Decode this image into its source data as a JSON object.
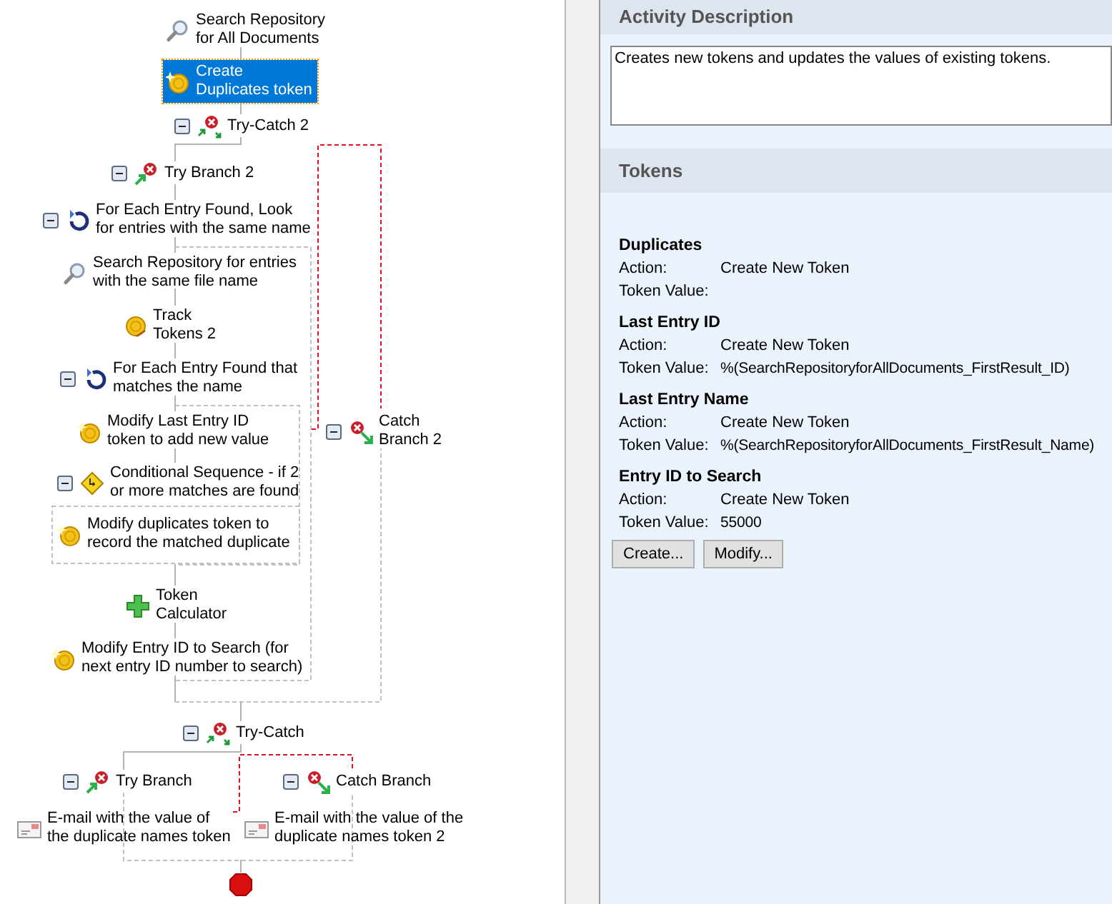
{
  "workflow": {
    "nodes": [
      {
        "kind": "search",
        "lines": [
          "Search Repository",
          "for All Documents"
        ],
        "selected": false
      },
      {
        "kind": "token",
        "lines": [
          "Create",
          "Duplicates token"
        ],
        "selected": true
      },
      {
        "kind": "trycatch",
        "lines": [
          "Try-Catch 2"
        ],
        "selected": false,
        "expanded": true
      },
      {
        "kind": "trybranch",
        "lines": [
          "Try Branch 2"
        ],
        "selected": false,
        "expanded": true
      },
      {
        "kind": "foreach",
        "lines": [
          "For Each Entry Found, Look",
          "for entries with the same name"
        ],
        "selected": false,
        "expanded": true
      },
      {
        "kind": "search",
        "lines": [
          "Search Repository for entries",
          "with the same file name"
        ],
        "selected": false
      },
      {
        "kind": "track",
        "lines": [
          "Track",
          "Tokens 2"
        ],
        "selected": false
      },
      {
        "kind": "foreach",
        "lines": [
          "For Each Entry Found that",
          "matches the name"
        ],
        "selected": false,
        "expanded": true
      },
      {
        "kind": "token",
        "lines": [
          "Modify Last Entry ID",
          "token to add new value"
        ],
        "selected": false
      },
      {
        "kind": "catchbranch",
        "lines": [
          "Catch",
          "Branch 2"
        ],
        "selected": false,
        "expanded": true
      },
      {
        "kind": "conditional",
        "lines": [
          "Conditional Sequence - if 2",
          "or more matches are found"
        ],
        "selected": false,
        "expanded": true
      },
      {
        "kind": "token",
        "lines": [
          "Modify duplicates token to",
          "record the matched duplicate"
        ],
        "selected": false
      },
      {
        "kind": "calculator",
        "lines": [
          "Token",
          "Calculator"
        ],
        "selected": false
      },
      {
        "kind": "token",
        "lines": [
          "Modify Entry ID to Search (for",
          "next entry ID number to search)"
        ],
        "selected": false
      },
      {
        "kind": "trycatch",
        "lines": [
          "Try-Catch"
        ],
        "selected": false,
        "expanded": true
      },
      {
        "kind": "trybranch",
        "lines": [
          "Try Branch"
        ],
        "selected": false,
        "expanded": true
      },
      {
        "kind": "catchbranch",
        "lines": [
          "Catch Branch"
        ],
        "selected": false,
        "expanded": true
      },
      {
        "kind": "email",
        "lines": [
          "E-mail with the value of",
          "the duplicate names token"
        ],
        "selected": false
      },
      {
        "kind": "email",
        "lines": [
          "E-mail with the value of the",
          "duplicate names token 2"
        ],
        "selected": false
      },
      {
        "kind": "end",
        "selected": false
      }
    ]
  },
  "activity_description": {
    "heading": "Activity Description",
    "text": "Creates new tokens and updates the values of existing tokens."
  },
  "tokens": {
    "heading": "Tokens",
    "items": [
      {
        "name": "Duplicates",
        "action_label": "Action:",
        "action": "Create New Token",
        "value_label": "Token Value:"
      },
      {
        "name": "Last Entry ID",
        "action_label": "Action:",
        "action": "Create New Token",
        "value_label": "Token Value:",
        "value": "%(SearchRepositoryforAllDocuments_FirstResult_ID)"
      },
      {
        "name": "Last Entry Name",
        "action_label": "Action:",
        "action": "Create New Token",
        "value_label": "Token Value:",
        "value": "%(SearchRepositoryforAllDocuments_FirstResult_Name)"
      },
      {
        "name": "Entry ID to Search",
        "action_label": "Action:",
        "action": "Create New Token",
        "value_label": "Token Value:",
        "value": "55000"
      }
    ]
  },
  "buttons": [
    "Create...",
    "Modify..."
  ]
}
